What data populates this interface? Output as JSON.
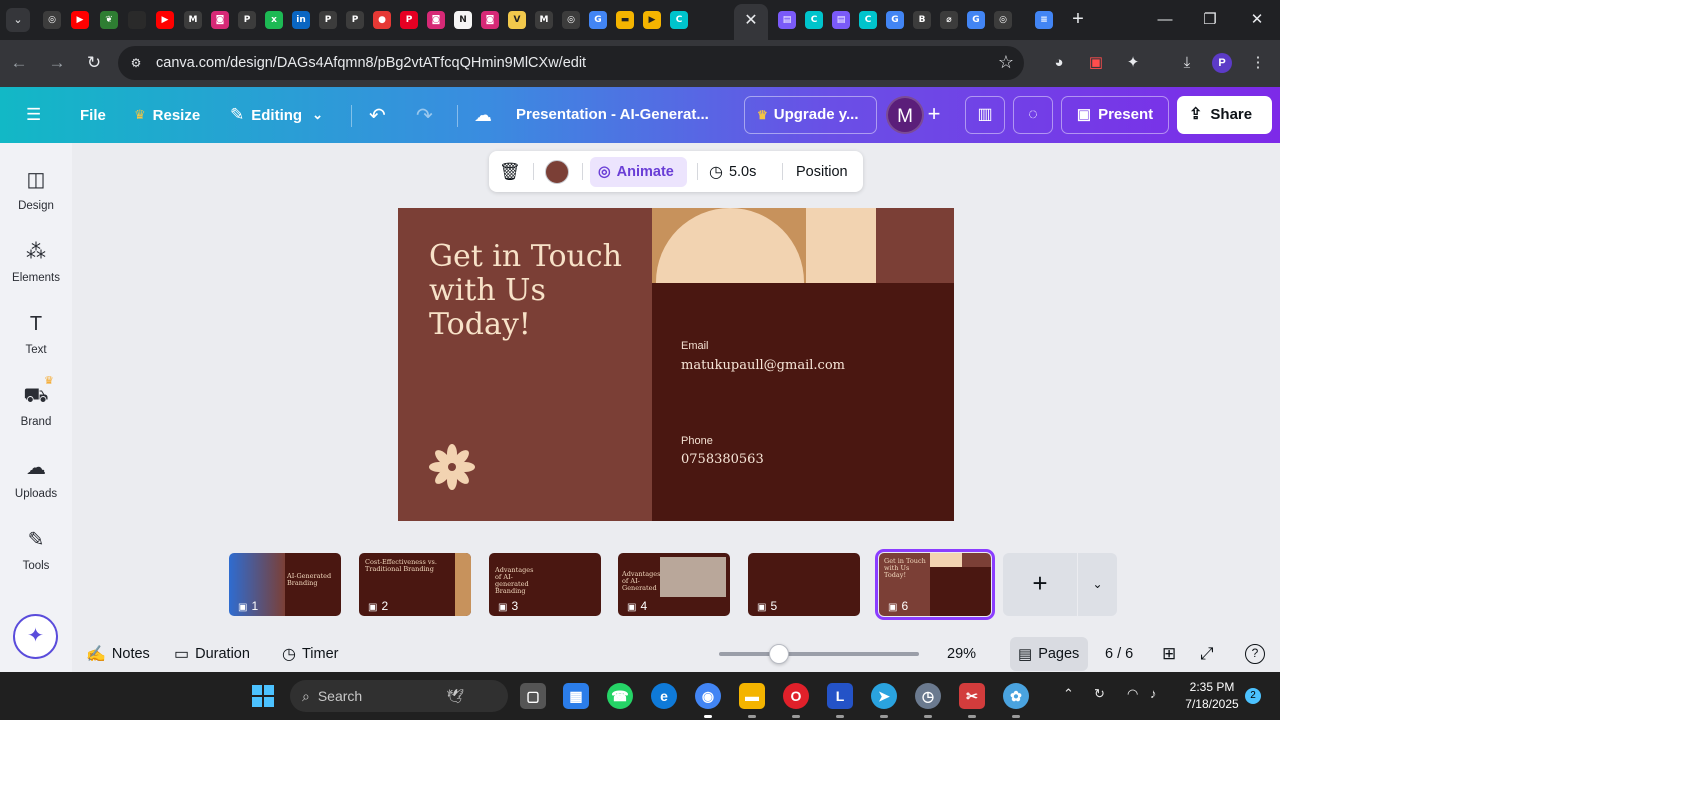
{
  "browser": {
    "url": "canva.com/design/DAGs4Afqmn8/pBg2vtATfcqQHmin9MlCXw/edit",
    "active_tab_close": "✕",
    "new_tab": "+"
  },
  "header": {
    "menu_icon": "menu-icon",
    "file": "File",
    "resize": "Resize",
    "editing": "Editing",
    "title": "Presentation - AI-Generat...",
    "upgrade": "Upgrade y...",
    "avatar_initial": "M",
    "present": "Present",
    "share": "Share",
    "accent": "#7d2ae8"
  },
  "sidebar": {
    "items": [
      {
        "label": "Design",
        "icon": "design-icon"
      },
      {
        "label": "Elements",
        "icon": "elements-icon"
      },
      {
        "label": "Text",
        "icon": "text-icon"
      },
      {
        "label": "Brand",
        "icon": "brand-icon"
      },
      {
        "label": "Uploads",
        "icon": "uploads-icon"
      },
      {
        "label": "Tools",
        "icon": "tools-icon"
      }
    ]
  },
  "context_toolbar": {
    "color": "#7b3f36",
    "animate": "Animate",
    "duration": "5.0s",
    "position": "Position"
  },
  "slide": {
    "title": "Get in Touch with Us Today!",
    "email_label": "Email",
    "email_value": "matukupaull@gmail.com",
    "phone_label": "Phone",
    "phone_value": "0758380563",
    "bg_color": "#7b3f36",
    "dark_color": "#4a1711",
    "accent_color": "#f2d3b1"
  },
  "thumbnails": [
    {
      "num": "1",
      "title": "AI-Generated Branding"
    },
    {
      "num": "2",
      "title": "Cost-Effectiveness vs. Traditional Branding"
    },
    {
      "num": "3",
      "title": "Advantages of AI-generated Branding"
    },
    {
      "num": "4",
      "title": "Advantages of AI-Generated"
    },
    {
      "num": "5",
      "title": ""
    },
    {
      "num": "6",
      "title": "Get in Touch with Us Today!"
    }
  ],
  "bottom_bar": {
    "notes": "Notes",
    "duration": "Duration",
    "timer": "Timer",
    "zoom": "29%",
    "pages": "Pages",
    "page_count": "6 / 6",
    "help": "?"
  },
  "taskbar": {
    "search": "Search",
    "time": "2:35 PM",
    "date": "7/18/2025",
    "notif_count": "2"
  }
}
